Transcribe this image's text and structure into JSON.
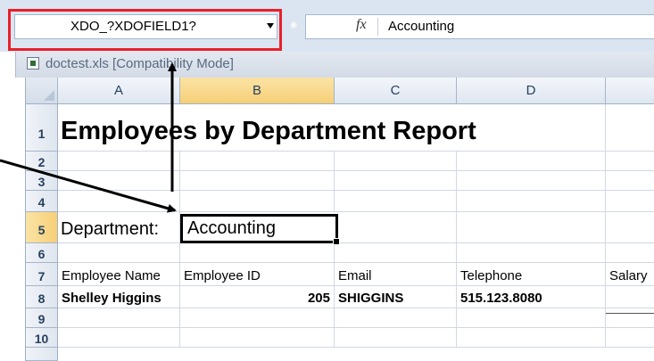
{
  "formula_bar": {
    "name_box_value": "XDO_?XDOFIELD1?",
    "fx_label": "fx",
    "formula_value": "Accounting"
  },
  "workbook": {
    "title": "doctest.xls  [Compatibility Mode]"
  },
  "grid": {
    "columns": [
      "A",
      "B",
      "C",
      "D"
    ],
    "selected_column": "B",
    "rows": [
      "1",
      "2",
      "3",
      "4",
      "5",
      "6",
      "7",
      "8",
      "9",
      "10"
    ],
    "selected_row": "5",
    "active_cell": "B5"
  },
  "cells": {
    "A1": "Employees by Department Report",
    "A5": "Department:",
    "B5": "Accounting",
    "A7": "Employee Name",
    "B7": "Employee ID",
    "C7": "Email",
    "D7": "Telephone",
    "E7": "Salary",
    "A8": "Shelley Higgins",
    "B8": "205",
    "C8": "SHIGGINS",
    "D8": "515.123.8080"
  },
  "annotations": {
    "highlight_color": "#e8202a",
    "arrow_color": "#000000"
  }
}
